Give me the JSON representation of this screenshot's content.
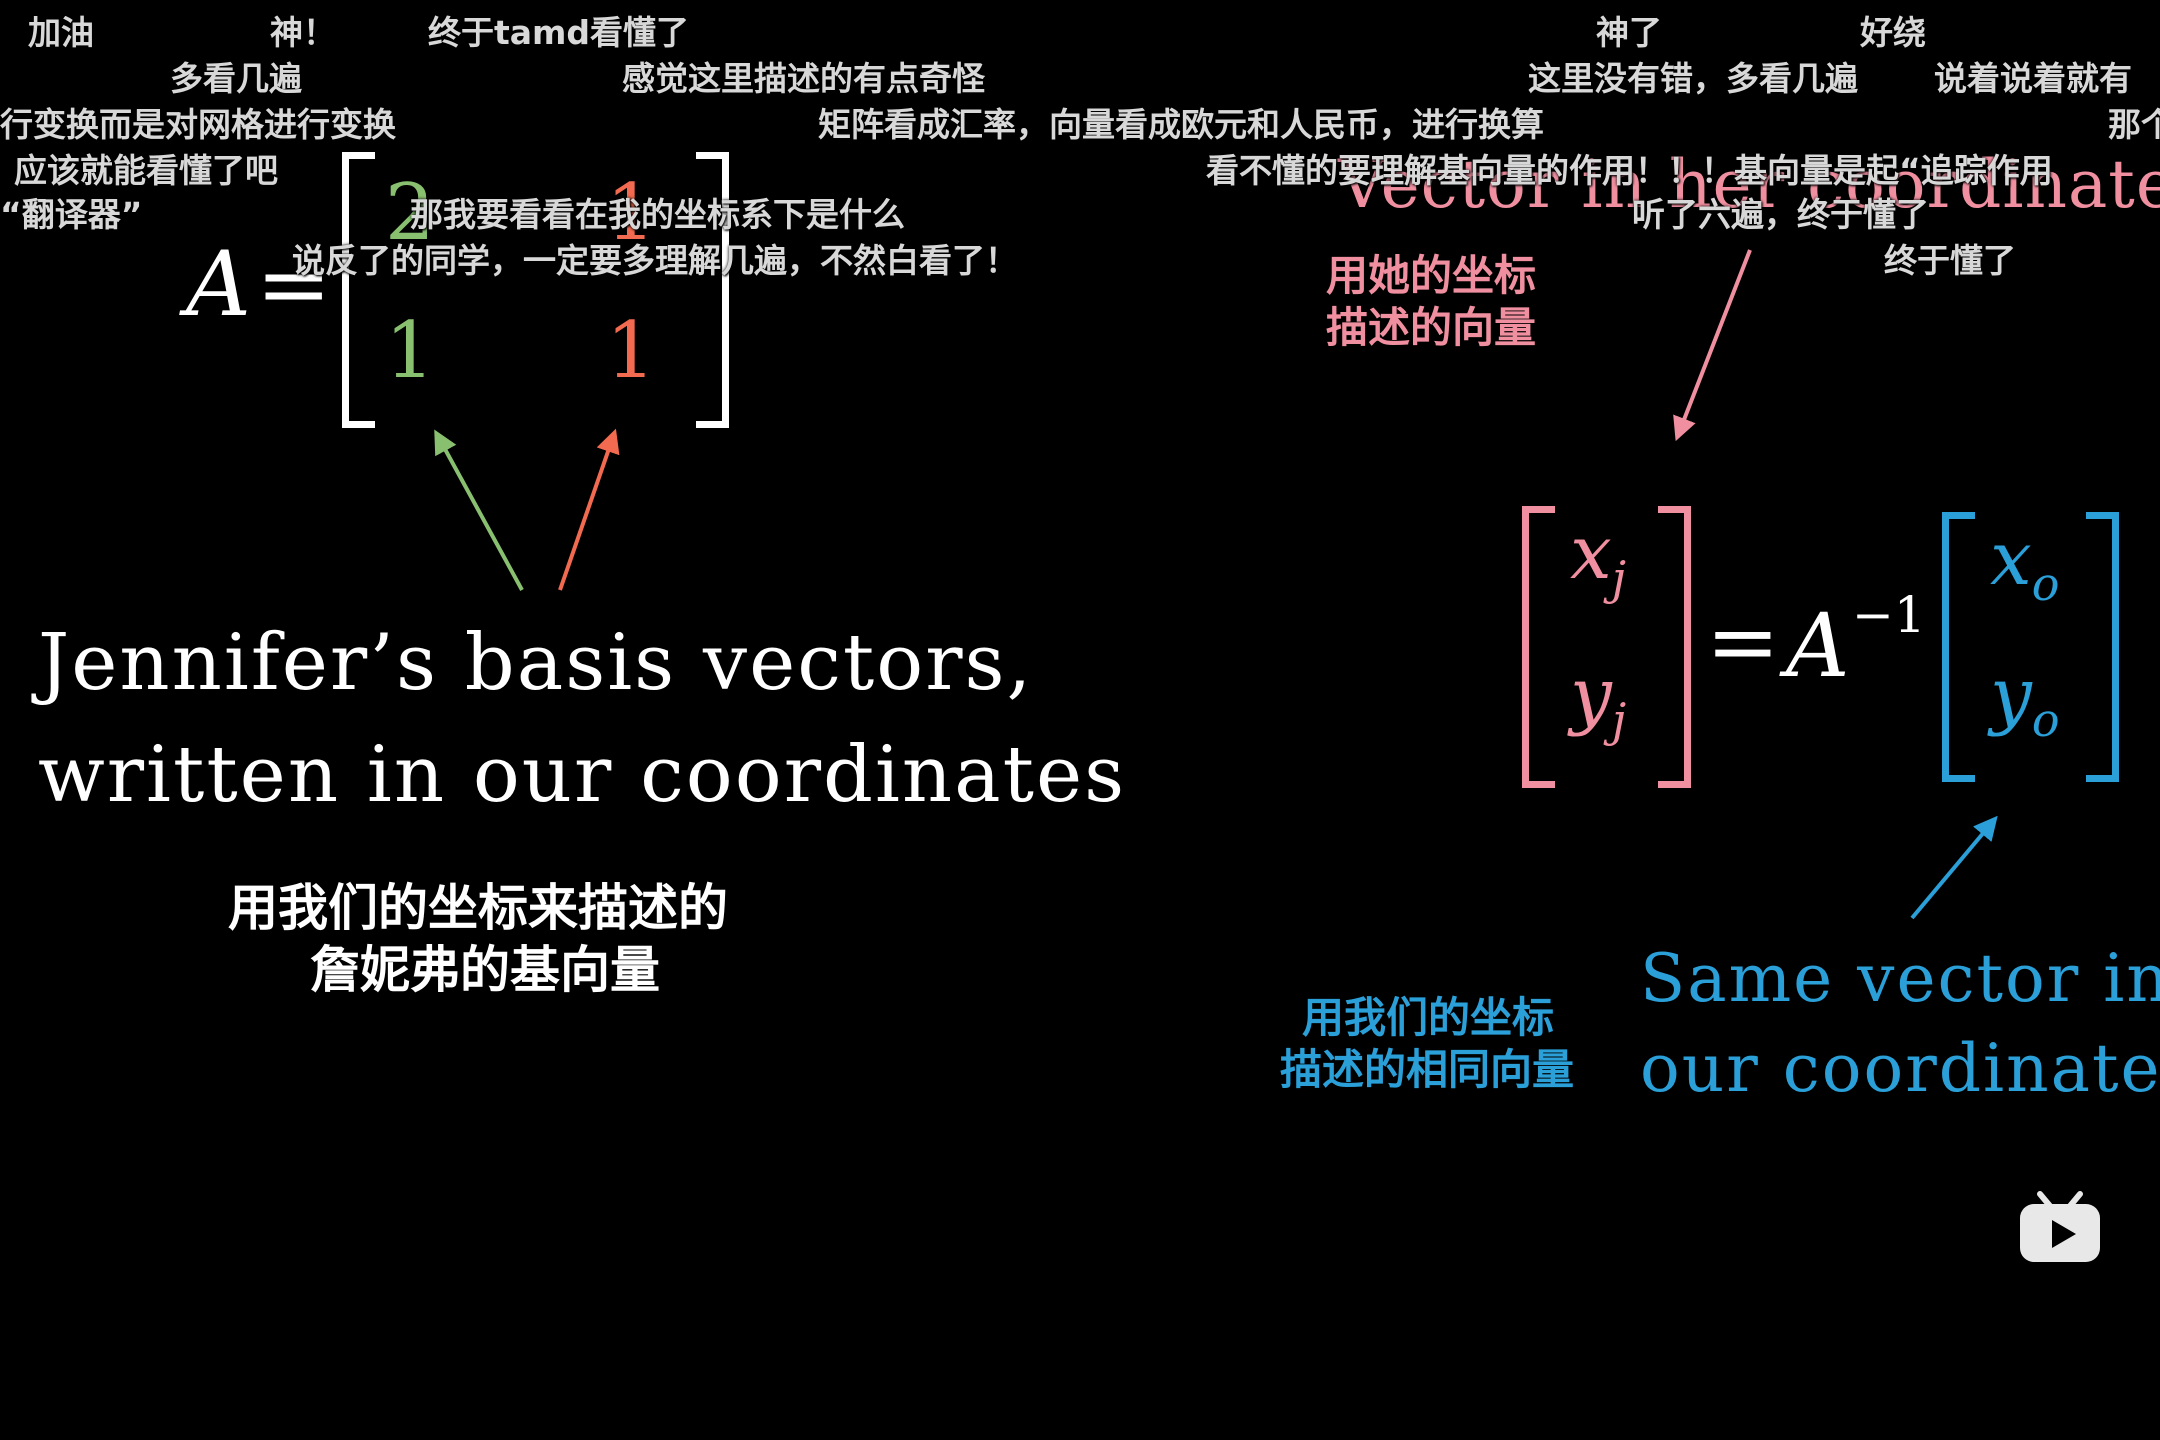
{
  "colors": {
    "background": "#000000",
    "green": "#88c070",
    "red": "#f26a4f",
    "pink": "#f08fa0",
    "blue": "#2a9fd8",
    "white": "#ffffff",
    "danmaku": "#d8d8d8"
  },
  "matrix": {
    "symbol": "A",
    "equals": "=",
    "top_left": "2",
    "top_right": "1",
    "bottom_left": "1",
    "bottom_right": "1"
  },
  "left_caption": {
    "line1": "Jennifer’s basis vectors,",
    "line2": "written in our coordinates",
    "cn_line1": "用我们的坐标来描述的",
    "cn_line2": "詹妮弗的基向量"
  },
  "right_top": {
    "title": "Vector in her coordinates",
    "cn_line1": "用她的坐标",
    "cn_line2": "描述的向量"
  },
  "equation": {
    "xj_var": "x",
    "xj_sub": "j",
    "yj_var": "y",
    "yj_sub": "j",
    "equals": "=",
    "A": "A",
    "inverse": "−1",
    "xo_var": "x",
    "xo_sub": "o",
    "yo_var": "y",
    "yo_sub": "o"
  },
  "right_bottom": {
    "line1": "Same vector in",
    "line2": "our coordinates",
    "cn_line1": "用我们的坐标",
    "cn_line2": "描述的相同向量"
  },
  "danmaku": [
    "加油",
    "神！",
    "终于tamd看懂了",
    "多看几遍",
    "感觉这里描述的有点奇怪",
    "行变换而是对网格进行变换",
    "矩阵看成汇率，向量看成欧元和人民币，进行换算",
    "应该就能看懂了吧",
    "“翻译器”",
    "那我要看看在我的坐标系下是什么",
    "说反了的同学，一定要多理解几遍，不然白看了！",
    "神了",
    "好绕",
    "这里没有错，多看几遍",
    "说着说着就有",
    "那个",
    "看不懂的要理解基向量的作用！！！基向量是起“追踪作用",
    "听了六遍，终于懂了",
    "终于懂了"
  ],
  "logo": {
    "icon": "bilibili-tv-icon"
  }
}
